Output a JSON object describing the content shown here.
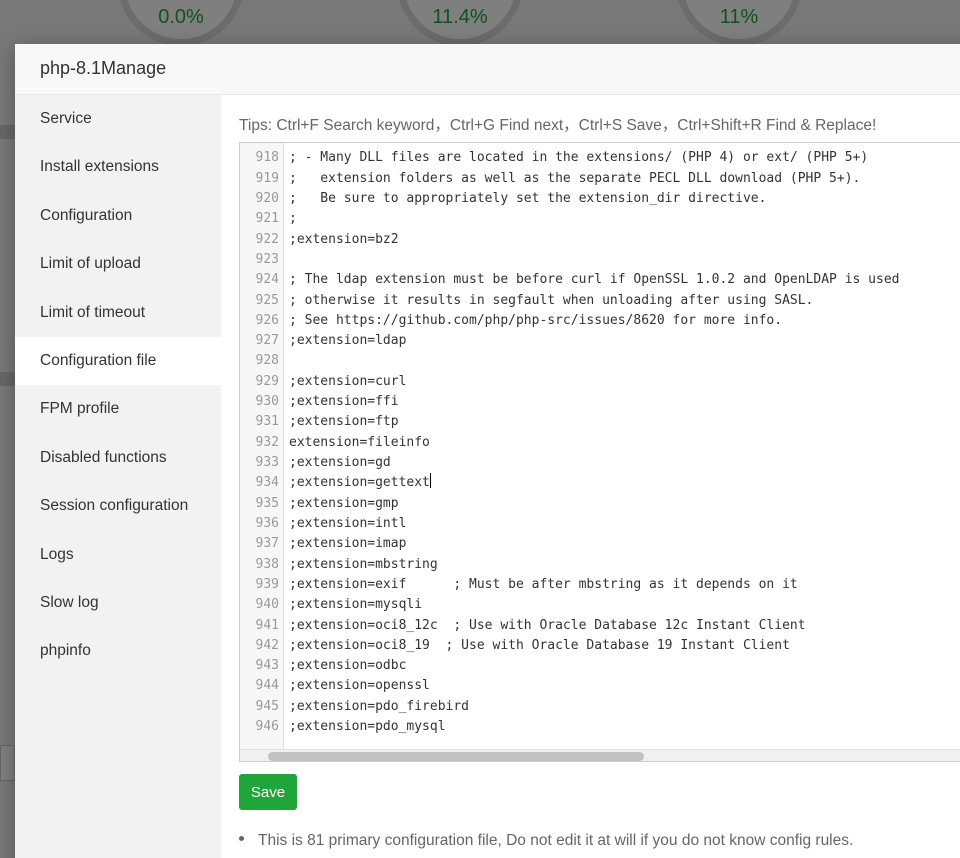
{
  "background": {
    "gauges": [
      "0.0%",
      "11.4%",
      "11%"
    ]
  },
  "modal": {
    "title": "php-8.1Manage",
    "sidebar": [
      "Service",
      "Install extensions",
      "Configuration",
      "Limit of upload",
      "Limit of timeout",
      "Configuration file",
      "FPM profile",
      "Disabled functions",
      "Session configuration",
      "Logs",
      "Slow log",
      "phpinfo"
    ],
    "active_item": "Configuration file",
    "tips": "Tips:  Ctrl+F Search keyword，Ctrl+G Find next，Ctrl+S Save，Ctrl+Shift+R Find & Replace!",
    "editor": {
      "lines": [
        {
          "n": "918",
          "t": "; - Many DLL files are located in the extensions/ (PHP 4) or ext/ (PHP 5+)"
        },
        {
          "n": "919",
          "t": ";   extension folders as well as the separate PECL DLL download (PHP 5+)."
        },
        {
          "n": "920",
          "t": ";   Be sure to appropriately set the extension_dir directive."
        },
        {
          "n": "921",
          "t": ";"
        },
        {
          "n": "922",
          "t": ";extension=bz2"
        },
        {
          "n": "923",
          "t": ""
        },
        {
          "n": "924",
          "t": "; The ldap extension must be before curl if OpenSSL 1.0.2 and OpenLDAP is used"
        },
        {
          "n": "925",
          "t": "; otherwise it results in segfault when unloading after using SASL."
        },
        {
          "n": "926",
          "t": "; See https://github.com/php/php-src/issues/8620 for more info."
        },
        {
          "n": "927",
          "t": ";extension=ldap"
        },
        {
          "n": "928",
          "t": ""
        },
        {
          "n": "929",
          "t": ";extension=curl"
        },
        {
          "n": "930",
          "t": ";extension=ffi"
        },
        {
          "n": "931",
          "t": ";extension=ftp"
        },
        {
          "n": "932",
          "t": "extension=fileinfo"
        },
        {
          "n": "933",
          "t": ";extension=gd"
        },
        {
          "n": "934",
          "t": ";extension=gettext"
        },
        {
          "n": "935",
          "t": ";extension=gmp"
        },
        {
          "n": "936",
          "t": ";extension=intl"
        },
        {
          "n": "937",
          "t": ";extension=imap"
        },
        {
          "n": "938",
          "t": ";extension=mbstring"
        },
        {
          "n": "939",
          "t": ";extension=exif      ; Must be after mbstring as it depends on it"
        },
        {
          "n": "940",
          "t": ";extension=mysqli"
        },
        {
          "n": "941",
          "t": ";extension=oci8_12c  ; Use with Oracle Database 12c Instant Client"
        },
        {
          "n": "942",
          "t": ";extension=oci8_19  ; Use with Oracle Database 19 Instant Client"
        },
        {
          "n": "943",
          "t": ";extension=odbc"
        },
        {
          "n": "944",
          "t": ";extension=openssl"
        },
        {
          "n": "945",
          "t": ";extension=pdo_firebird"
        },
        {
          "n": "946",
          "t": ";extension=pdo_mysql"
        }
      ],
      "cursor_line": "934"
    },
    "save_label": "Save",
    "note": "This is 81 primary configuration file, Do not edit it at will if you do not know config rules."
  },
  "colors": {
    "accent": "#20a53a",
    "sidebar_bg": "#f2f2f2"
  }
}
